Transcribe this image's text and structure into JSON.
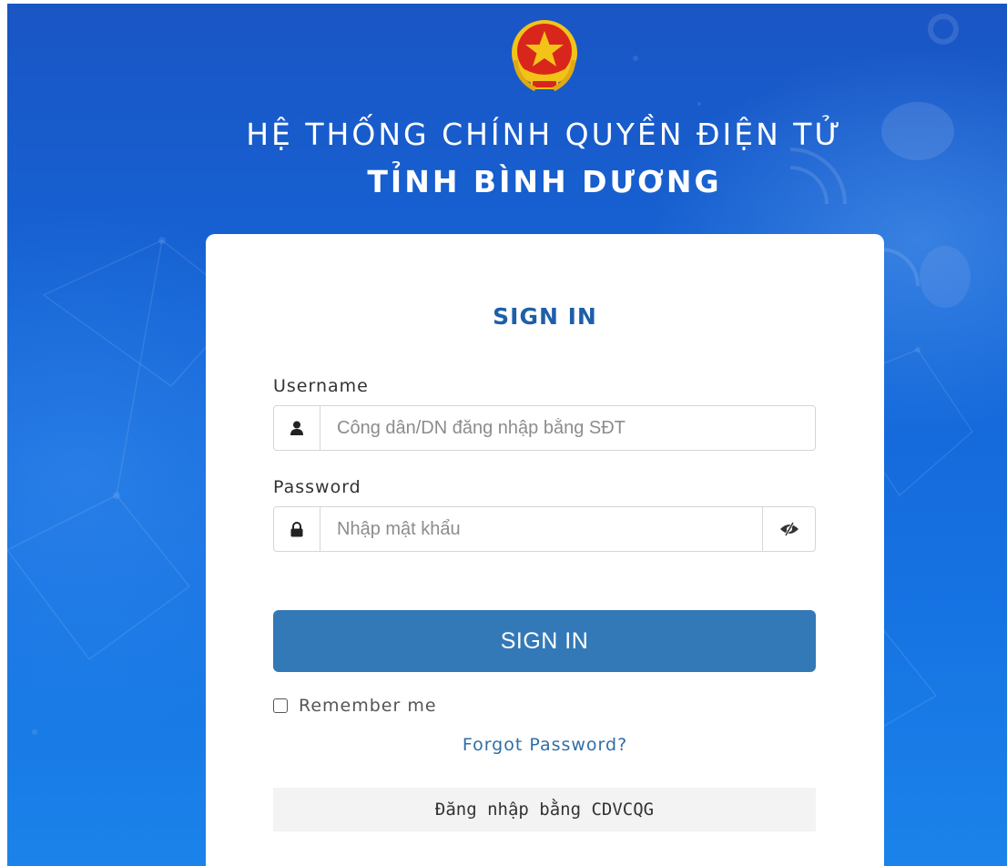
{
  "header": {
    "title_line1": "HỆ THỐNG CHÍNH QUYỀN ĐIỆN TỬ",
    "title_line2": "TỈNH BÌNH DƯƠNG"
  },
  "login": {
    "title": "SIGN IN",
    "username_label": "Username",
    "username_placeholder": "Công dân/DN đăng nhập bằng SĐT",
    "password_label": "Password",
    "password_placeholder": "Nhập mật khẩu",
    "submit_label": "SIGN IN",
    "remember_label": "Remember me",
    "remember_checked": false,
    "forgot_label": "Forgot Password?",
    "alt_login_label": "Đăng nhập bằng CDVCQG"
  },
  "icons": {
    "emblem": "national-emblem-icon",
    "user": "user-icon",
    "lock": "lock-icon",
    "toggle_password": "eye-slash-icon"
  },
  "colors": {
    "background": "#1564d6",
    "title_accent": "#1e5fa8",
    "button": "#3479b7",
    "link": "#2f6ea8",
    "emblem_red": "#d9261c",
    "emblem_gold": "#f3c318"
  }
}
